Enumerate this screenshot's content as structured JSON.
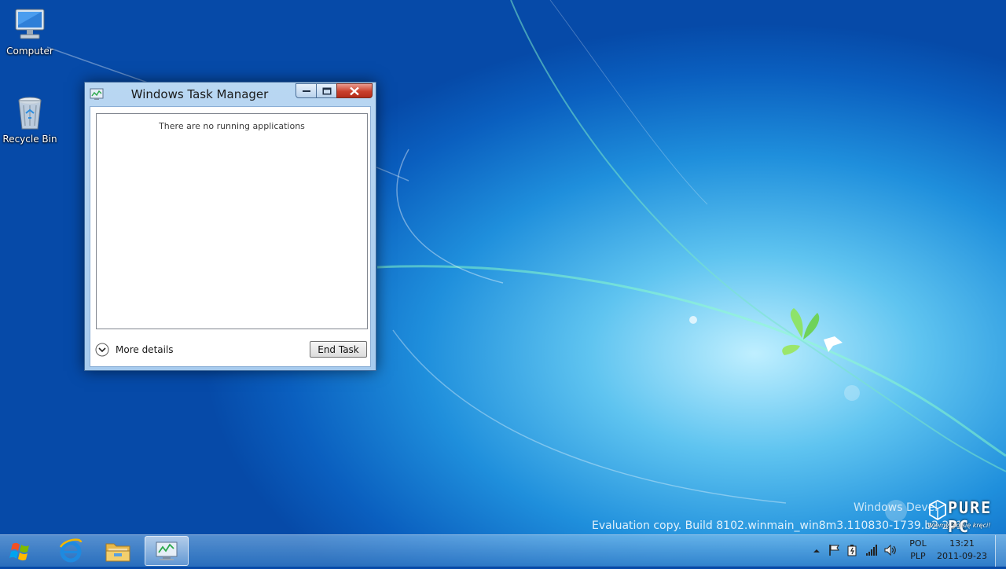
{
  "desktop": {
    "icons": [
      {
        "label": "Computer"
      },
      {
        "label": "Recycle Bin"
      }
    ],
    "watermark_edition": "Windows Devel",
    "watermark_build": "Evaluation copy. Build 8102.winmain_win8m3.110830-1739.b2 261",
    "brand_logo": "PURE PC",
    "brand_tagline": "Wiemy, co się kręci!"
  },
  "window": {
    "title": "Windows Task Manager",
    "empty_message": "There are no running applications",
    "more_details_label": "More details",
    "end_task_label": "End Task"
  },
  "taskbar": {
    "language": [
      "POL",
      "PLP"
    ],
    "time": "13:21",
    "date": "2011-09-23",
    "pinned": [
      "internet-explorer-icon",
      "file-explorer-icon",
      "task-manager-icon"
    ]
  },
  "colors": {
    "close_button": "#c9402c",
    "window_frame": "#b9d7f2",
    "desktop_blue": "#1f8fdc"
  }
}
